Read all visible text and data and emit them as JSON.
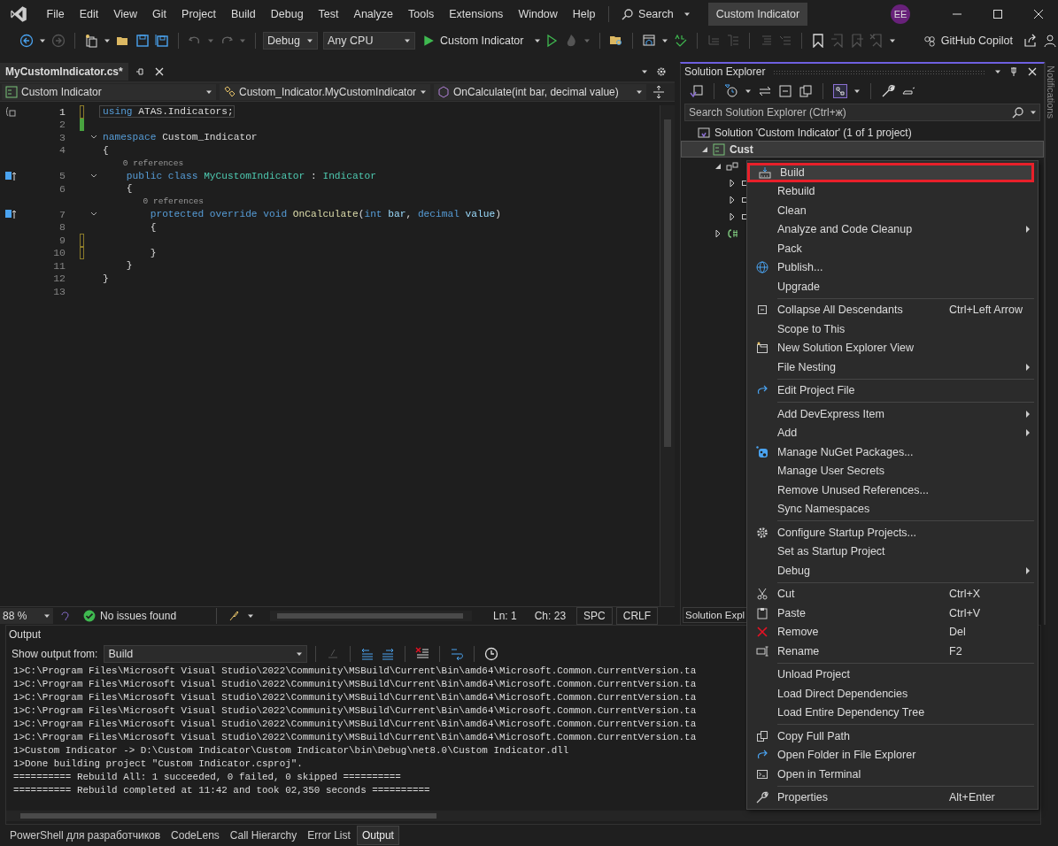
{
  "menu_bar": {
    "items": [
      "File",
      "Edit",
      "View",
      "Git",
      "Project",
      "Build",
      "Debug",
      "Test",
      "Analyze",
      "Tools",
      "Extensions",
      "Window",
      "Help"
    ],
    "search": "Search",
    "solution_title": "Custom Indicator",
    "avatar": "EE"
  },
  "toolbar": {
    "configuration": "Debug",
    "platform": "Any CPU",
    "run_target": "Custom Indicator",
    "copilot": "GitHub Copilot"
  },
  "editor": {
    "tab": {
      "label": "MyCustomIndicator.cs*",
      "selected": true
    },
    "nav": [
      "Custom Indicator",
      "Custom_Indicator.MyCustomIndicator",
      "OnCalculate(int bar, decimal value)"
    ],
    "lines": [
      {
        "kind": "code",
        "number": "1",
        "tokens": [
          {
            "kind": "keyword",
            "text": "using"
          },
          {
            "kind": "plain",
            "text": " ATAS.Indicators;"
          }
        ]
      },
      {
        "kind": "code",
        "number": "2"
      },
      {
        "kind": "code",
        "number": "3",
        "expanded": true,
        "tokens": [
          {
            "kind": "keyword",
            "text": "namespace"
          },
          {
            "kind": "plain",
            "text": " Custom_Indicator"
          }
        ]
      },
      {
        "kind": "code",
        "number": "4",
        "tokens": [
          {
            "kind": "plain",
            "text": "{"
          }
        ]
      },
      {
        "kind": "lens",
        "text": "    0 references"
      },
      {
        "kind": "code",
        "number": "5",
        "expanded": true,
        "tokens": [
          {
            "kind": "keyword",
            "text": "    public class"
          },
          {
            "kind": "type",
            "text": " MyCustomIndicator"
          },
          {
            "kind": "plain",
            "text": " : "
          },
          {
            "kind": "type",
            "text": "Indicator"
          }
        ]
      },
      {
        "kind": "code",
        "number": "6",
        "tokens": [
          {
            "kind": "plain",
            "text": "    {"
          }
        ]
      },
      {
        "kind": "lens",
        "text": "        0 references"
      },
      {
        "kind": "code",
        "number": "7",
        "expanded": true,
        "tokens": [
          {
            "kind": "keyword",
            "text": "        protected override void"
          },
          {
            "kind": "method",
            "text": " OnCalculate"
          },
          {
            "kind": "plain",
            "text": "("
          },
          {
            "kind": "keyword",
            "text": "int"
          },
          {
            "kind": "param",
            "text": " bar"
          },
          {
            "kind": "plain",
            "text": ", "
          },
          {
            "kind": "keyword",
            "text": "decimal"
          },
          {
            "kind": "param",
            "text": " value"
          },
          {
            "kind": "plain",
            "text": ")"
          }
        ]
      },
      {
        "kind": "code",
        "number": "8",
        "tokens": [
          {
            "kind": "plain",
            "text": "        {"
          }
        ]
      },
      {
        "kind": "code",
        "number": "9"
      },
      {
        "kind": "code",
        "number": "10",
        "tokens": [
          {
            "kind": "plain",
            "text": "        }"
          }
        ]
      },
      {
        "kind": "code",
        "number": "11",
        "tokens": [
          {
            "kind": "plain",
            "text": "    }"
          }
        ]
      },
      {
        "kind": "code",
        "number": "12",
        "tokens": [
          {
            "kind": "plain",
            "text": "}"
          }
        ]
      },
      {
        "kind": "code",
        "number": "13"
      }
    ],
    "status": {
      "zoom": "88 %",
      "issues": "No issues found",
      "line": "Ln: 1",
      "column": "Ch: 23",
      "whitespace": "SPC",
      "line_ending": "CRLF"
    }
  },
  "solution_explorer": {
    "title": "Solution Explorer",
    "search_placeholder": "Search Solution Explorer (Ctrl+ж)",
    "tree": [
      {
        "label": "Solution 'Custom Indicator' (1 of 1 project)",
        "children": [
          {
            "label": "Cust",
            "expanded": true,
            "selected": true,
            "children": [
              {
                "kind": "dependencies",
                "expanded": true,
                "children": [
                  {
                    "kind": "node",
                    "expanded": false
                  },
                  {
                    "kind": "node",
                    "expanded": false
                  },
                  {
                    "kind": "node",
                    "expanded": false
                  }
                ]
              },
              {
                "kind": "csharp",
                "expanded": false
              }
            ]
          }
        ]
      }
    ],
    "bottom_tab": "Solution Expl",
    "side_tab": "Notifications"
  },
  "context_menu": [
    {
      "kind": "item",
      "label": "Build",
      "selected": true
    },
    {
      "kind": "item",
      "label": "Rebuild",
      "selected": false
    },
    {
      "kind": "item",
      "label": "Clean",
      "selected": false
    },
    {
      "kind": "item",
      "label": "Analyze and Code Cleanup",
      "submenu": true,
      "selected": false
    },
    {
      "kind": "item",
      "label": "Pack",
      "selected": false
    },
    {
      "kind": "item",
      "label": "Publish...",
      "selected": false
    },
    {
      "kind": "item",
      "label": "Upgrade",
      "selected": false
    },
    {
      "kind": "separator"
    },
    {
      "kind": "item",
      "label": "Collapse All Descendants",
      "shortcut": "Ctrl+Left Arrow",
      "selected": false
    },
    {
      "kind": "item",
      "label": "Scope to This",
      "selected": false
    },
    {
      "kind": "item",
      "label": "New Solution Explorer View",
      "selected": false
    },
    {
      "kind": "item",
      "label": "File Nesting",
      "submenu": true,
      "selected": false
    },
    {
      "kind": "separator"
    },
    {
      "kind": "item",
      "label": "Edit Project File",
      "selected": false
    },
    {
      "kind": "separator"
    },
    {
      "kind": "item",
      "label": "Add DevExpress Item",
      "submenu": true,
      "selected": false
    },
    {
      "kind": "item",
      "label": "Add",
      "submenu": true,
      "selected": false
    },
    {
      "kind": "item",
      "label": "Manage NuGet Packages...",
      "selected": false
    },
    {
      "kind": "item",
      "label": "Manage User Secrets",
      "selected": false
    },
    {
      "kind": "item",
      "label": "Remove Unused References...",
      "selected": false
    },
    {
      "kind": "item",
      "label": "Sync Namespaces",
      "selected": false
    },
    {
      "kind": "separator"
    },
    {
      "kind": "item",
      "label": "Configure Startup Projects...",
      "selected": false
    },
    {
      "kind": "item",
      "label": "Set as Startup Project",
      "selected": false
    },
    {
      "kind": "item",
      "label": "Debug",
      "submenu": true,
      "selected": false
    },
    {
      "kind": "separator"
    },
    {
      "kind": "item",
      "label": "Cut",
      "shortcut": "Ctrl+X",
      "selected": false
    },
    {
      "kind": "item",
      "label": "Paste",
      "shortcut": "Ctrl+V",
      "selected": false
    },
    {
      "kind": "item",
      "label": "Remove",
      "shortcut": "Del",
      "selected": false
    },
    {
      "kind": "item",
      "label": "Rename",
      "shortcut": "F2",
      "selected": false
    },
    {
      "kind": "separator"
    },
    {
      "kind": "item",
      "label": "Unload Project",
      "selected": false
    },
    {
      "kind": "item",
      "label": "Load Direct Dependencies",
      "selected": false
    },
    {
      "kind": "item",
      "label": "Load Entire Dependency Tree",
      "selected": false
    },
    {
      "kind": "separator"
    },
    {
      "kind": "item",
      "label": "Copy Full Path",
      "selected": false
    },
    {
      "kind": "item",
      "label": "Open Folder in File Explorer",
      "selected": false
    },
    {
      "kind": "item",
      "label": "Open in Terminal",
      "selected": false
    },
    {
      "kind": "separator"
    },
    {
      "kind": "item",
      "label": "Properties",
      "shortcut": "Alt+Enter",
      "selected": false
    }
  ],
  "output": {
    "title": "Output",
    "source_label": "Show output from:",
    "source": "Build",
    "lines": [
      "1>C:\\Program Files\\Microsoft Visual Studio\\2022\\Community\\MSBuild\\Current\\Bin\\amd64\\Microsoft.Common.CurrentVersion.ta",
      "1>C:\\Program Files\\Microsoft Visual Studio\\2022\\Community\\MSBuild\\Current\\Bin\\amd64\\Microsoft.Common.CurrentVersion.ta",
      "1>C:\\Program Files\\Microsoft Visual Studio\\2022\\Community\\MSBuild\\Current\\Bin\\amd64\\Microsoft.Common.CurrentVersion.ta",
      "1>C:\\Program Files\\Microsoft Visual Studio\\2022\\Community\\MSBuild\\Current\\Bin\\amd64\\Microsoft.Common.CurrentVersion.ta",
      "1>C:\\Program Files\\Microsoft Visual Studio\\2022\\Community\\MSBuild\\Current\\Bin\\amd64\\Microsoft.Common.CurrentVersion.ta",
      "1>C:\\Program Files\\Microsoft Visual Studio\\2022\\Community\\MSBuild\\Current\\Bin\\amd64\\Microsoft.Common.CurrentVersion.ta",
      "1>Custom Indicator -> D:\\Custom Indicator\\Custom Indicator\\bin\\Debug\\net8.0\\Custom Indicator.dll",
      "1>Done building project \"Custom Indicator.csproj\".",
      "========== Rebuild All: 1 succeeded, 0 failed, 0 skipped ==========",
      "========== Rebuild completed at 11:42 and took 02,350 seconds =========="
    ]
  },
  "bottom_tabs": [
    {
      "label": "PowerShell для разработчиков",
      "selected": false
    },
    {
      "label": "CodeLens",
      "selected": false
    },
    {
      "label": "Call Hierarchy",
      "selected": false
    },
    {
      "label": "Error List",
      "selected": false
    },
    {
      "label": "Output",
      "selected": true
    }
  ]
}
